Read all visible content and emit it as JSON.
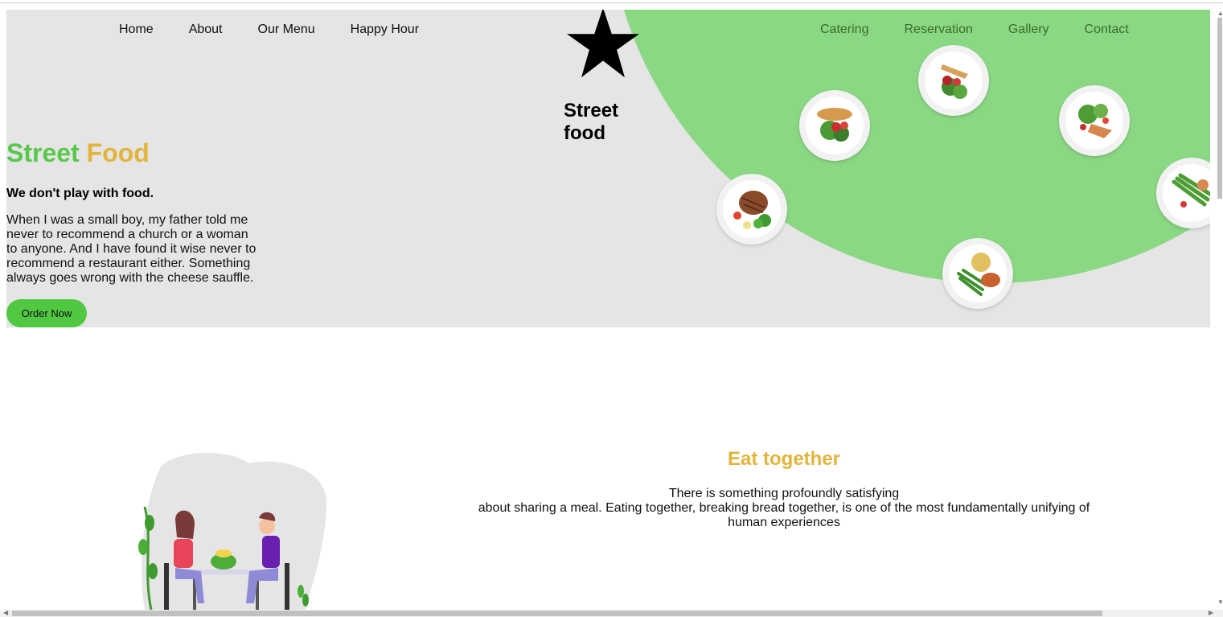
{
  "nav": {
    "left": [
      "Home",
      "About",
      "Our Menu",
      "Happy Hour"
    ],
    "right": [
      "Catering",
      "Reservation",
      "Gallery",
      "Contact"
    ]
  },
  "logo": {
    "line1": "Street",
    "line2": "food",
    "icon": "star-icon"
  },
  "hero": {
    "title_part1": "Street",
    "title_part2": "Food",
    "tagline": "We don't play with food.",
    "quote": "When I was a small boy, my father told me never to recommend a church or a woman to anyone. And I have found it wise never to recommend a restaurant either. Something always goes wrong with the cheese sauffle.",
    "button": "Order Now"
  },
  "section": {
    "title": "Eat together",
    "line1": "There is something profoundly satisfying",
    "line2": "about sharing a meal. Eating together, breaking bread together, is one of the most fundamentally unifying of",
    "line3": "human experiences"
  },
  "colors": {
    "green_accent": "#57c84a",
    "yellow_accent": "#e3b43c",
    "hero_bg": "#e5e5e5",
    "circle_green": "#8bd884",
    "button_green": "#51c842"
  }
}
